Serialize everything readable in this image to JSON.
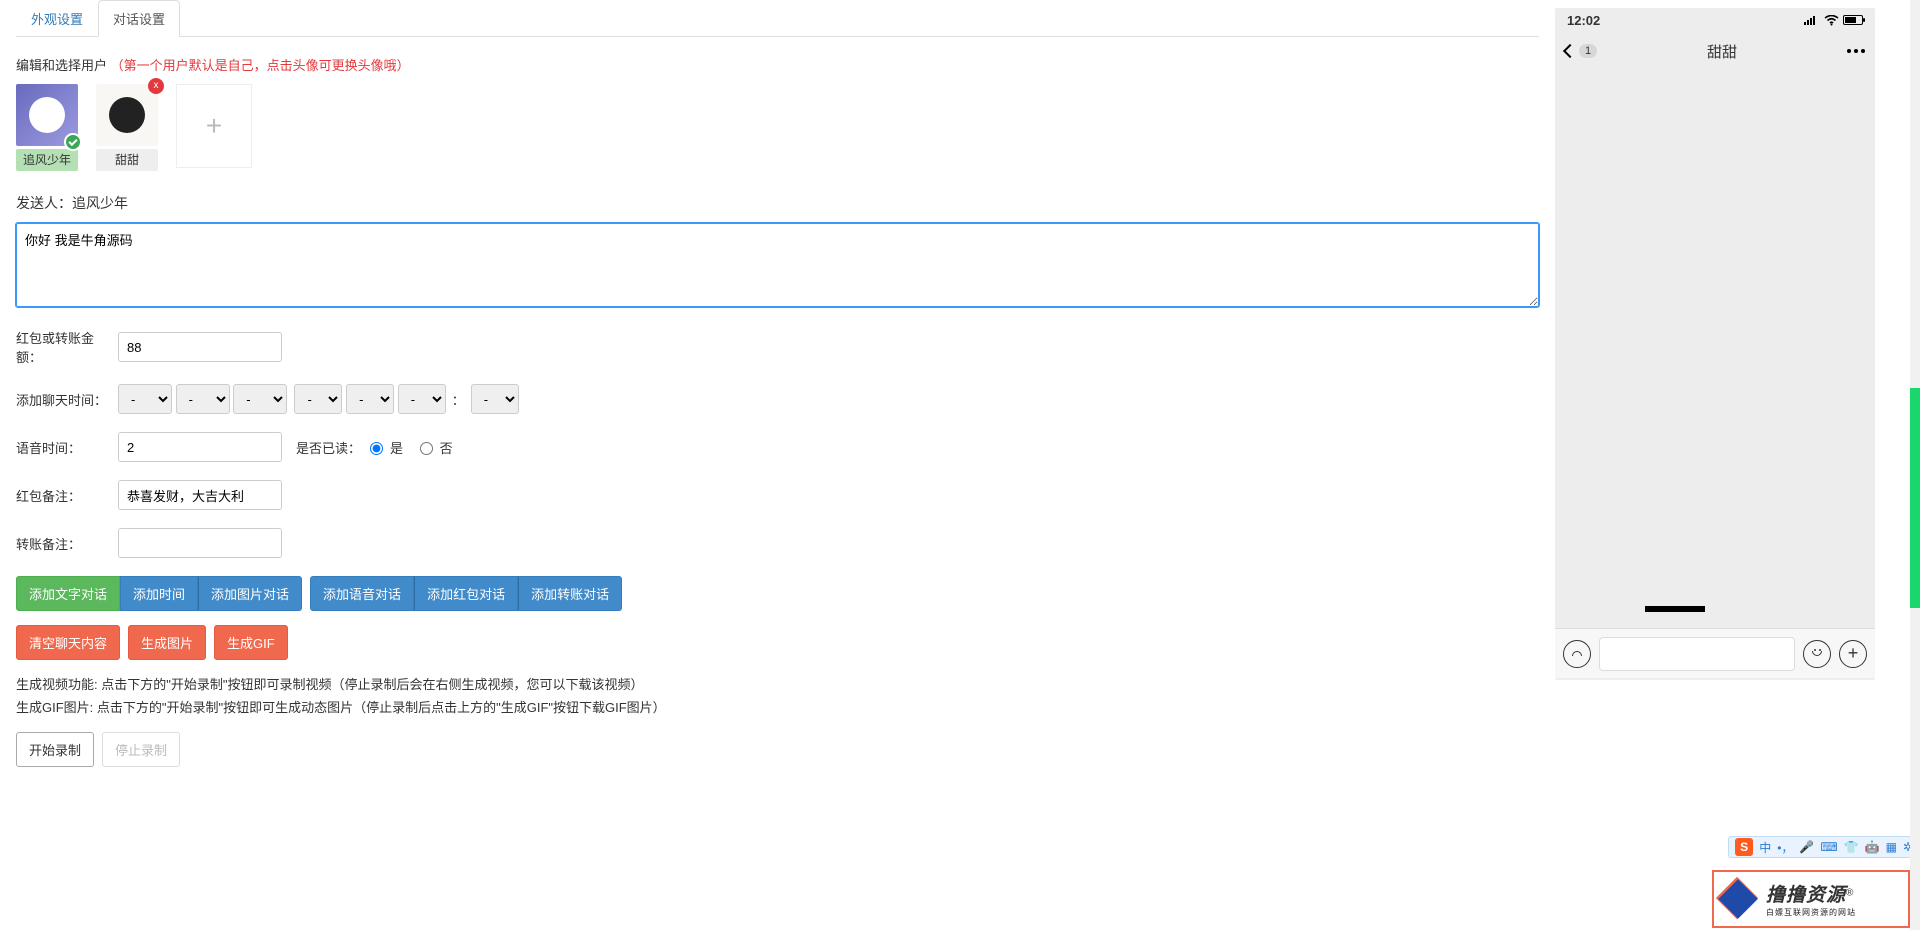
{
  "tabs": {
    "appearance": "外观设置",
    "dialog": "对话设置"
  },
  "edit_label": "编辑和选择用户",
  "edit_hint": "（第一个用户默认是自己，点击头像可更换头像哦）",
  "avatars": [
    {
      "name": "追风少年",
      "selected": true
    },
    {
      "name": "甜甜",
      "selected": false
    }
  ],
  "sender_label": "发送人：",
  "sender_name": "追风少年",
  "message_text": "你好 我是牛角源码",
  "amount_label": "红包或转账金额：",
  "amount_value": "88",
  "chat_time_label": "添加聊天时间：",
  "dash": "-",
  "colon": "：",
  "voice_time_label": "语音时间：",
  "voice_time_value": "2",
  "read_label": "是否已读：",
  "read_yes": "是",
  "read_no": "否",
  "red_remark_label": "红包备注：",
  "red_remark_value": "恭喜发财，大吉大利",
  "transfer_remark_label": "转账备注：",
  "transfer_remark_value": "",
  "btn": {
    "add_text": "添加文字对话",
    "add_time": "添加时间",
    "add_image": "添加图片对话",
    "add_voice": "添加语音对话",
    "add_red": "添加红包对话",
    "add_transfer": "添加转账对话",
    "clear": "清空聊天内容",
    "gen_img": "生成图片",
    "gen_gif": "生成GIF",
    "start_record": "开始录制",
    "stop_record": "停止录制"
  },
  "note_video": "生成视频功能: 点击下方的\"开始录制\"按钮即可录制视频（停止录制后会在右侧生成视频，您可以下载该视频）",
  "note_gif": "生成GIF图片: 点击下方的\"开始录制\"按钮即可生成动态图片（停止录制后点击上方的\"生成GIF\"按钮下载GIF图片）",
  "phone": {
    "time": "12:02",
    "back_badge": "1",
    "title": "甜甜"
  },
  "ime": {
    "s": "S",
    "zh": "中"
  },
  "brand": {
    "main_a": "撸撸资源",
    "r": "®",
    "sub": "白嫖互联网资源的网站"
  }
}
